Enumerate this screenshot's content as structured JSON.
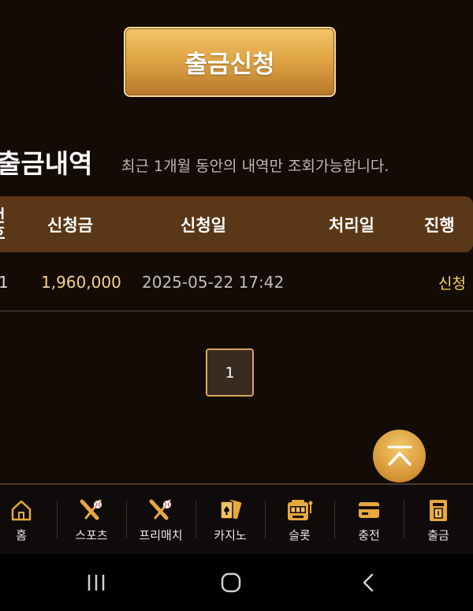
{
  "withdraw_button": {
    "label": "출금신청"
  },
  "history": {
    "title": "출금내역",
    "note": "최근 1개월 동안의 내역만 조회가능합니다.",
    "columns": {
      "no_line1": "번",
      "no_line2": "호",
      "amount": "신청금",
      "request_date": "신청일",
      "process_date": "처리일",
      "status": "진행"
    },
    "rows": [
      {
        "no": "1",
        "amount": "1,960,000",
        "request_date": "2025-05-22 17:42",
        "process_date": "",
        "status": "신청"
      }
    ]
  },
  "pagination": {
    "current": "1"
  },
  "bottom_nav": {
    "items": [
      {
        "label": "홈",
        "icon": "home-icon"
      },
      {
        "label": "스포츠",
        "icon": "baseball-bat-icon"
      },
      {
        "label": "프리매치",
        "icon": "baseball-bat-icon"
      },
      {
        "label": "카지노",
        "icon": "playing-cards-icon"
      },
      {
        "label": "슬롯",
        "icon": "slot-machine-icon"
      },
      {
        "label": "충전",
        "icon": "credit-card-icon"
      },
      {
        "label": "출금",
        "icon": "atm-icon"
      }
    ]
  },
  "colors": {
    "background": "#140b07",
    "accent_gold": "#e0a646",
    "table_header": "#5a3716",
    "amount_text": "#f5d38c",
    "status_text": "#f3d84a"
  }
}
